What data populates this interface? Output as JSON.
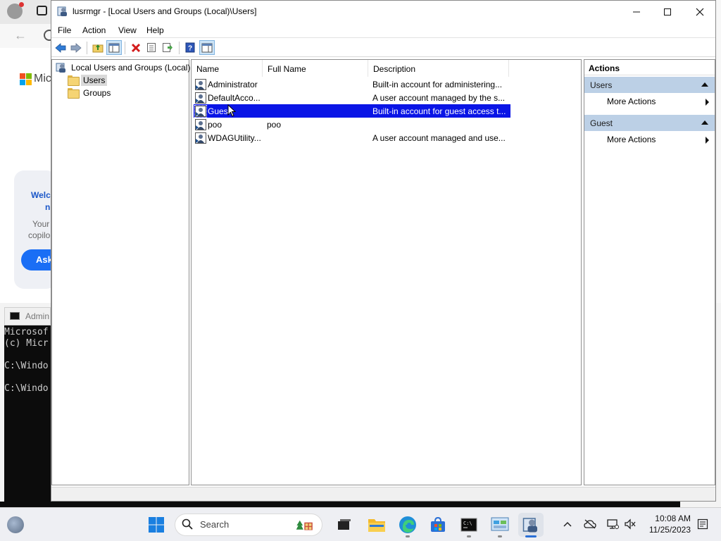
{
  "background": {
    "edge_brand_text": "Mic",
    "welcome_line1": "Welc",
    "welcome_line2": "n",
    "your_text": "Your",
    "copilot_text": "copilo",
    "ask_button": "Ask",
    "cmd_label": "Admin",
    "cmd_lines": "Microsof\n(c) Micr\n\nC:\\Windo\n\nC:\\Windo"
  },
  "window": {
    "title": "lusrmgr - [Local Users and Groups (Local)\\Users]",
    "menu": [
      "File",
      "Action",
      "View",
      "Help"
    ],
    "toolbar_icons": [
      "back-arrow-icon",
      "forward-arrow-icon",
      "up-folder-icon",
      "show-hide-tree-icon",
      "delete-icon",
      "properties-icon",
      "export-list-icon",
      "help-icon",
      "show-hide-action-pane-icon"
    ]
  },
  "tree": {
    "root": "Local Users and Groups (Local)",
    "children": [
      {
        "label": "Users",
        "selected": true
      },
      {
        "label": "Groups",
        "selected": false
      }
    ]
  },
  "list": {
    "columns": [
      "Name",
      "Full Name",
      "Description"
    ],
    "rows": [
      {
        "name": "Administrator",
        "full_name": "",
        "description": "Built-in account for administering...",
        "selected": false
      },
      {
        "name": "DefaultAcco...",
        "full_name": "",
        "description": "A user account managed by the s...",
        "selected": false
      },
      {
        "name": "Guest",
        "full_name": "",
        "description": "Built-in account for guest access t...",
        "selected": true
      },
      {
        "name": "poo",
        "full_name": "poo",
        "description": "",
        "selected": false
      },
      {
        "name": "WDAGUtility...",
        "full_name": "",
        "description": "A user account managed and use...",
        "selected": false
      }
    ]
  },
  "actions": {
    "header": "Actions",
    "sections": [
      {
        "title": "Users",
        "items": [
          "More Actions"
        ]
      },
      {
        "title": "Guest",
        "items": [
          "More Actions"
        ]
      }
    ]
  },
  "taskbar": {
    "search_placeholder": "Search",
    "time": "10:08 AM",
    "date": "11/25/2023",
    "colors": {
      "accent": "#0078d4",
      "selection": "#0a15e6"
    }
  }
}
